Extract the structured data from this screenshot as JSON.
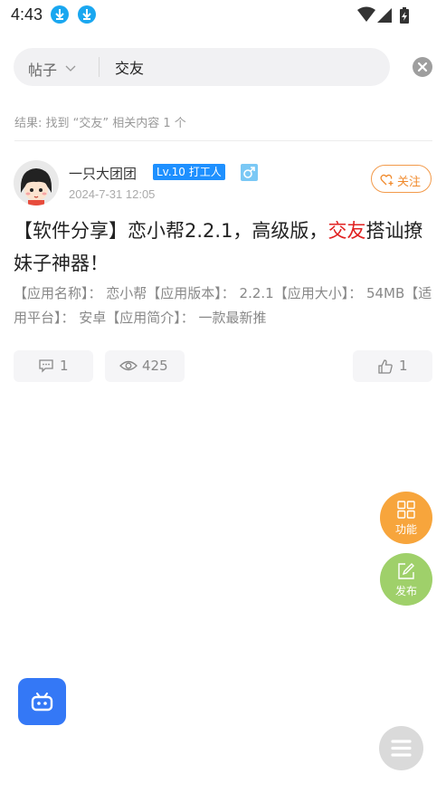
{
  "status_bar": {
    "time": "4:43",
    "icons": [
      "download-icon",
      "download-icon",
      "wifi-icon",
      "signal-icon",
      "battery-charging-icon"
    ]
  },
  "search": {
    "scope": "帖子",
    "query": "交友"
  },
  "result": {
    "text": "结果: 找到 “交友” 相关内容 1 个"
  },
  "post": {
    "author": "一只大团团",
    "level": "Lv.10 打工人",
    "gender": "male",
    "time": "2024-7-31 12:05",
    "follow_label": "关注",
    "title_before": "【软件分享】恋小帮2.2.1，高级版，",
    "title_highlight": "交友",
    "title_after": "搭讪撩妹子神器！",
    "excerpt": "【应用名称】： 恋小帮【应用版本】： 2.2.1【应用大小】： 54MB【适用平台】： 安卓【应用简介】： 一款最新推",
    "comments": "1",
    "views": "425",
    "likes": "1"
  },
  "fabs": {
    "function_label": "功能",
    "publish_label": "发布"
  },
  "colors": {
    "accent_orange": "#f7a53c",
    "accent_green": "#9fd06a",
    "highlight_red": "#e02020",
    "badge_blue": "#1e90ff",
    "robot_blue": "#3478f6"
  }
}
